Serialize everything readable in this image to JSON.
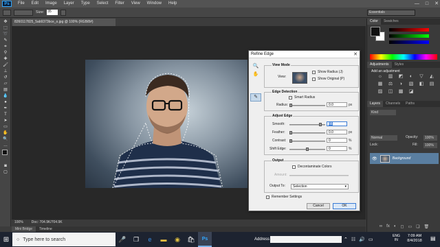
{
  "app": {
    "logo": "Ps"
  },
  "menu": [
    "File",
    "Edit",
    "Image",
    "Layer",
    "Type",
    "Select",
    "Filter",
    "View",
    "Window",
    "Help"
  ],
  "window_controls": [
    "—",
    "□",
    "✕"
  ],
  "options": {
    "size_label": "Size:",
    "size_value": "35",
    "workspace": "Essentials"
  },
  "document": {
    "tab_title": "8260117825_5ab9373bce_o.jpg @ 100% (RGB/8#)",
    "zoom": "100%",
    "doc_info": "Doc: 704.9K/704.9K"
  },
  "bottom_tabs": [
    "Mini Bridge",
    "Timeline"
  ],
  "panels": {
    "color_tabs": [
      "Color",
      "Swatches"
    ],
    "adjustment_tabs": [
      "Adjustments",
      "Styles"
    ],
    "adjustments_title": "Add an adjustment",
    "adjustment_icons": [
      "☼",
      "▥",
      "◩",
      "◐",
      "▽",
      "◭",
      "▦",
      "⚖",
      "◑",
      "▧",
      "◧",
      "▤",
      "▨",
      "◫",
      "▩",
      "◪",
      "▣",
      "◨"
    ],
    "layers_tabs": [
      "Layers",
      "Channels",
      "Paths"
    ],
    "kind_label": "Kind",
    "blend_mode": "Normal",
    "opacity_label": "Opacity:",
    "opacity_value": "100%",
    "lock_label": "Lock:",
    "fill_label": "Fill:",
    "fill_value": "100%",
    "layer_name": "Background",
    "layer_footer_icons": [
      "∞",
      "fx",
      "◐",
      "◻",
      "▭",
      "❏",
      "🗑"
    ]
  },
  "dialog": {
    "title": "Refine Edge",
    "view_mode": {
      "title": "View Mode",
      "view_label": "View:",
      "show_radius": "Show Radius (J)",
      "show_original": "Show Original (P)"
    },
    "edge_detection": {
      "title": "Edge Detection",
      "smart_radius": "Smart Radius",
      "radius_label": "Radius:",
      "radius_value": "0.0",
      "radius_unit": "px"
    },
    "adjust_edge": {
      "title": "Adjust Edge",
      "smooth_label": "Smooth:",
      "smooth_value": "88",
      "feather_label": "Feather:",
      "feather_value": "0.0",
      "feather_unit": "px",
      "contrast_label": "Contrast:",
      "contrast_value": "0",
      "contrast_unit": "%",
      "shift_label": "Shift Edge:",
      "shift_value": "0",
      "shift_unit": "%"
    },
    "output": {
      "title": "Output",
      "decontaminate": "Decontaminate Colors",
      "amount_label": "Amount:",
      "output_to_label": "Output To:",
      "output_to_value": "Selection"
    },
    "remember": "Remember Settings",
    "cancel": "Cancel",
    "ok": "OK"
  },
  "taskbar": {
    "search_placeholder": "Type here to search",
    "address_label": "Address",
    "lang_top": "ENG",
    "lang_bottom": "IN",
    "time": "7:09 AM",
    "date": "8/4/2018"
  },
  "colors": {
    "accent": "#3a7bd5",
    "layer_selected": "#5a7ea0",
    "photoshop_blue": "#31a8ff"
  }
}
